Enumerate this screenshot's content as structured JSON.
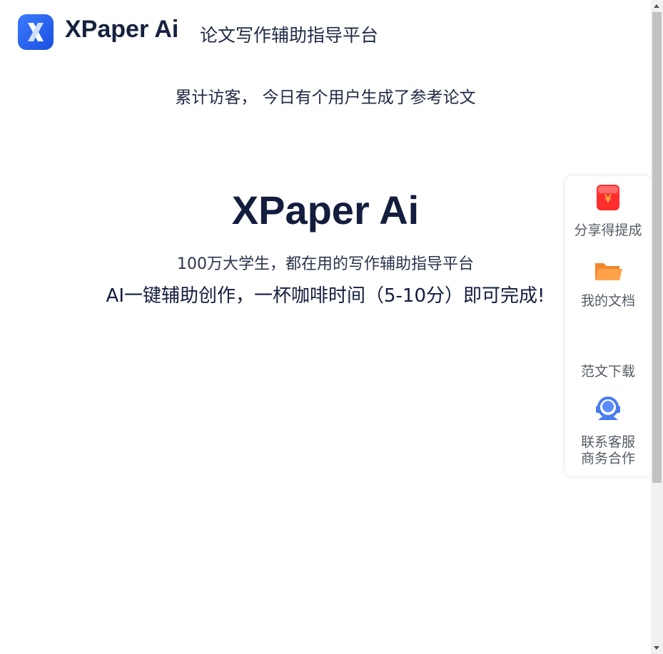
{
  "header": {
    "brand": "XPaper Ai",
    "tagline": "论文写作辅助指导平台",
    "logo_icon": "x-logo-icon",
    "accent": "#2563eb"
  },
  "stats": {
    "visitors_line": "累计访客， 今日有个用户生成了参考论文"
  },
  "hero": {
    "title": "XPaper Ai",
    "subtitle": "100万大学生，都在用的写作辅助指导平台",
    "slogan": "AI一键辅助创作，一杯咖啡时间（5-10分）即可完成!"
  },
  "sidebar": {
    "items": [
      {
        "label": "分享得提成",
        "icon": "red-envelope-icon"
      },
      {
        "label": "我的文档",
        "icon": "folder-icon"
      },
      {
        "label": "范文下载",
        "icon": "download-icon"
      },
      {
        "label": "联系客服",
        "label2": "商务合作",
        "icon": "customer-service-icon"
      }
    ]
  }
}
